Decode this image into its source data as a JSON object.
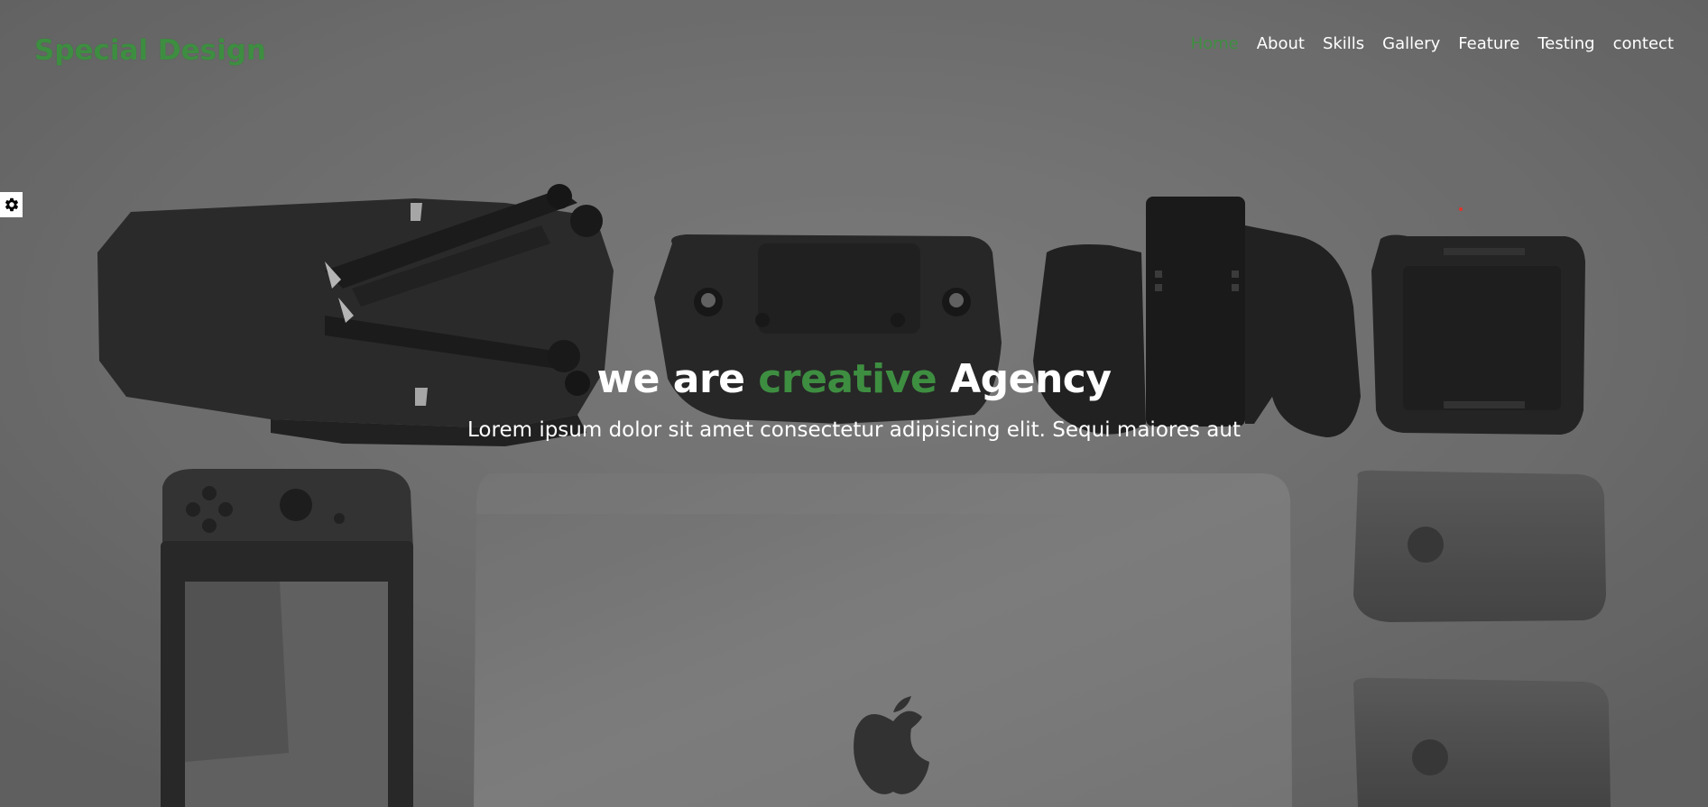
{
  "brand": {
    "logo_text": "Special Design"
  },
  "nav": {
    "items": [
      {
        "label": "Home",
        "active": true
      },
      {
        "label": "About",
        "active": false
      },
      {
        "label": "Skills",
        "active": false
      },
      {
        "label": "Gallery",
        "active": false
      },
      {
        "label": "Feature",
        "active": false
      },
      {
        "label": "Testing",
        "active": false
      },
      {
        "label": "contect",
        "active": false
      }
    ]
  },
  "hero": {
    "title_part1": "we are ",
    "title_accent": "creative",
    "title_part2": " Agency",
    "subtitle": "Lorem ipsum dolor sit amet consectetur adipisicing elit. Sequi maiores aut"
  },
  "settings": {
    "icon": "gear-icon"
  },
  "colors": {
    "accent": "#3e8e41",
    "nav_text": "#ffffff",
    "settings_bg": "#ffffff"
  }
}
